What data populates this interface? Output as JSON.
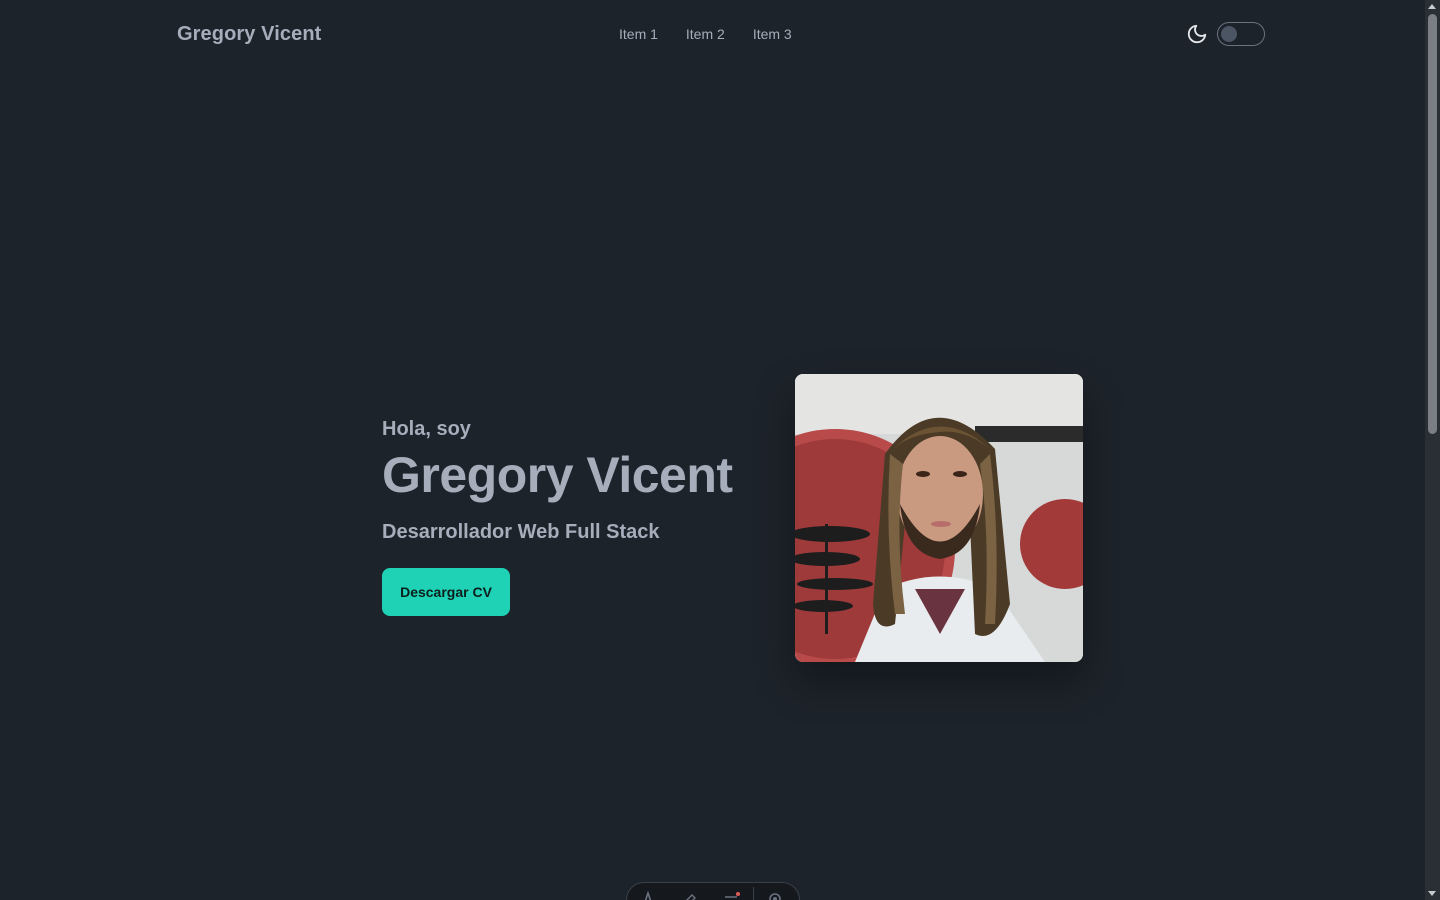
{
  "navbar": {
    "brand": "Gregory Vicent",
    "menu": [
      {
        "label": "Item 1"
      },
      {
        "label": "Item 2"
      },
      {
        "label": "Item 3"
      }
    ],
    "theme_icon": "moon-icon",
    "theme_toggle": {
      "on": false
    }
  },
  "hero": {
    "greeting": "Hola, soy",
    "name": "Gregory Vicent",
    "role": "Desarrollador Web Full Stack",
    "cta_label": "Descargar CV",
    "photo_icon": "profile-photo"
  },
  "dock": {
    "icons": [
      "font-icon",
      "paint-icon",
      "menu-icon",
      "settings-icon"
    ]
  },
  "colors": {
    "background": "#1d232a",
    "text": "#a6adbb",
    "accent": "#1fd1b5"
  }
}
